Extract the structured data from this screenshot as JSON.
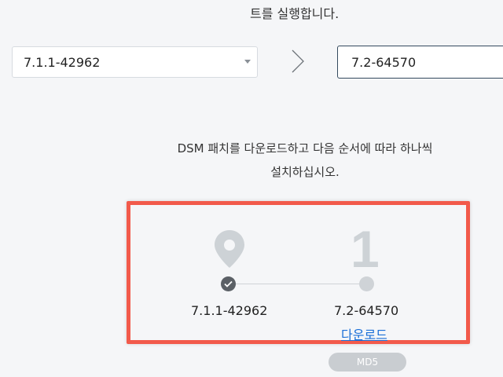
{
  "intro": {
    "text": "트를 실행합니다."
  },
  "version_selector": {
    "current_value": "7.1.1-42962",
    "arrow_icon": "chevron-right-icon",
    "target_value": "7.2-64570"
  },
  "instruction": {
    "line1": "DSM 패치를 다운로드하고 다음 순서에 따라 하나씩",
    "line2": "설치하십시오."
  },
  "steps": {
    "current_icon": "map-pin-icon",
    "current_version": "7.1.1-42962",
    "next_step_number": "1",
    "next_version": "7.2-64570",
    "download_label": "다운로드",
    "md5_label": "MD5"
  },
  "colors": {
    "highlight": "#f25a4b",
    "link": "#1a6fd8",
    "done_dot": "#5b6066",
    "pending": "#cfd3d7"
  }
}
